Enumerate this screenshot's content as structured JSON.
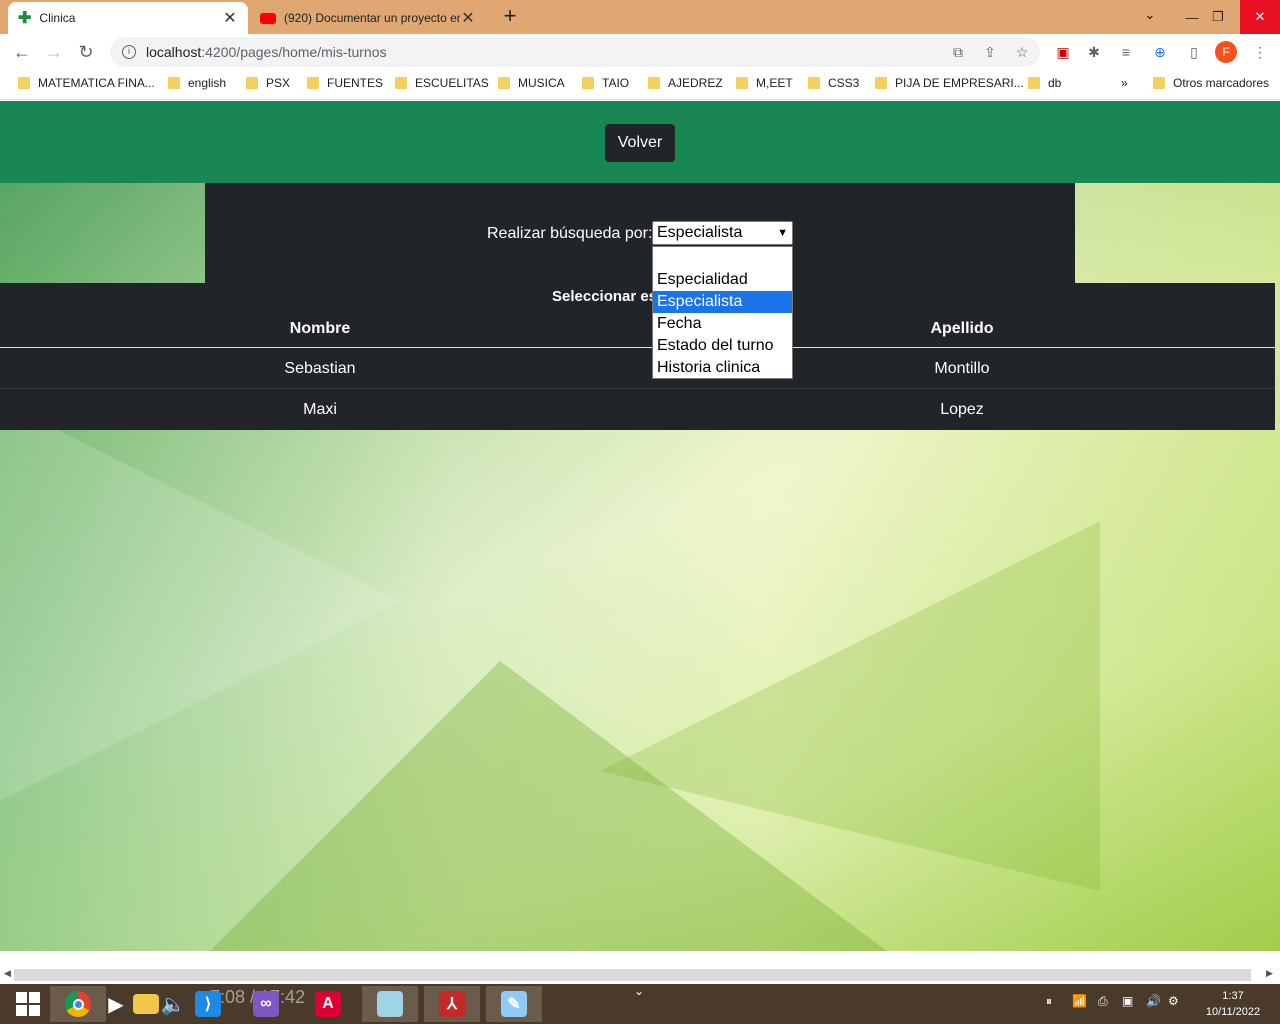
{
  "browser": {
    "tabs": [
      {
        "title": "Clinica",
        "active": true
      },
      {
        "title": "(920) Documentar un proyecto en",
        "active": false
      }
    ],
    "url": {
      "host": "localhost",
      "path": ":4200/pages/home/mis-turnos"
    },
    "profile_initial": "F",
    "bookmarks": [
      "MATEMATICA FINA...",
      "english",
      "PSX",
      "FUENTES",
      "ESCUELITAS",
      "MUSICA",
      "TAIO",
      "AJEDREZ",
      "M,EET",
      "CSS3",
      "PIJA DE EMPRESARI...",
      "db"
    ],
    "bookmarks_overflow": "»",
    "other_bookmarks": "Otros marcadores"
  },
  "page": {
    "back_button": "Volver",
    "search_label": "Realizar búsqueda por:",
    "select_value": "Especialista",
    "select_options": [
      "",
      "Especialidad",
      "Especialista",
      "Fecha",
      "Estado del turno",
      "Historia clinica"
    ],
    "select_highlighted_index": 2,
    "table_caption": "Seleccionar es",
    "columns": [
      "Nombre",
      "Apellido"
    ],
    "rows": [
      [
        "Sebastian",
        "Montillo"
      ],
      [
        "Maxi",
        "Lopez"
      ]
    ],
    "colors": {
      "header": "#198754",
      "dark": "#212529",
      "accent": "#1a73e8"
    }
  },
  "taskbar": {
    "overlay": "7:08 / 17:42",
    "clock_time": "1:37",
    "clock_date": "10/11/2022",
    "apps": [
      "windows-start-icon",
      "chrome-icon",
      "media-play-icon",
      "file-explorer-icon",
      "volume-icon",
      "vscode-icon",
      "visual-studio-icon",
      "angular-icon",
      "notepad-icon",
      "acrobat-icon",
      "paint-icon"
    ]
  }
}
